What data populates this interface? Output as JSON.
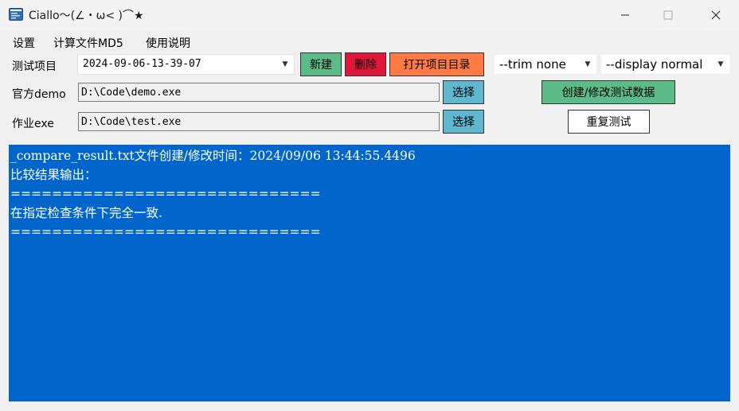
{
  "window": {
    "title": "Ciallo～(∠・ω< )⌒★",
    "icon": "app-window-icon",
    "controls": [
      "minimize-icon",
      "maximize-icon",
      "close-icon"
    ]
  },
  "menu": {
    "items": [
      "设置",
      "计算文件MD5",
      "使用说明"
    ]
  },
  "form": {
    "project_label": "测试项目",
    "project_value": "2024-09-06-13-39-07",
    "new_button": "新建",
    "delete_button": "删除",
    "open_dir_button": "打开项目目录",
    "trim_option": "--trim none",
    "display_option": "--display normal",
    "demo_label": "官方demo",
    "demo_path": "D:\\Code\\demo.exe",
    "demo_select_button": "选择",
    "homework_label": "作业exe",
    "homework_path": "D:\\Code\\test.exe",
    "homework_select_button": "选择",
    "create_data_button": "创建/修改测试数据",
    "retest_button": "重复测试"
  },
  "colors": {
    "new_button": "#5dbb8a",
    "delete_button": "#e0173a",
    "open_dir_button": "#ff7a45",
    "select_button": "#5fb8d0",
    "create_data_button": "#5dbb8a",
    "output_background": "#0066cc"
  },
  "output": {
    "lines": [
      "_compare_result.txt文件创建/修改时间：2024/09/06 13:44:55.4496",
      "比较结果输出：",
      "==============================",
      "在指定检查条件下完全一致.",
      "=============================="
    ]
  }
}
